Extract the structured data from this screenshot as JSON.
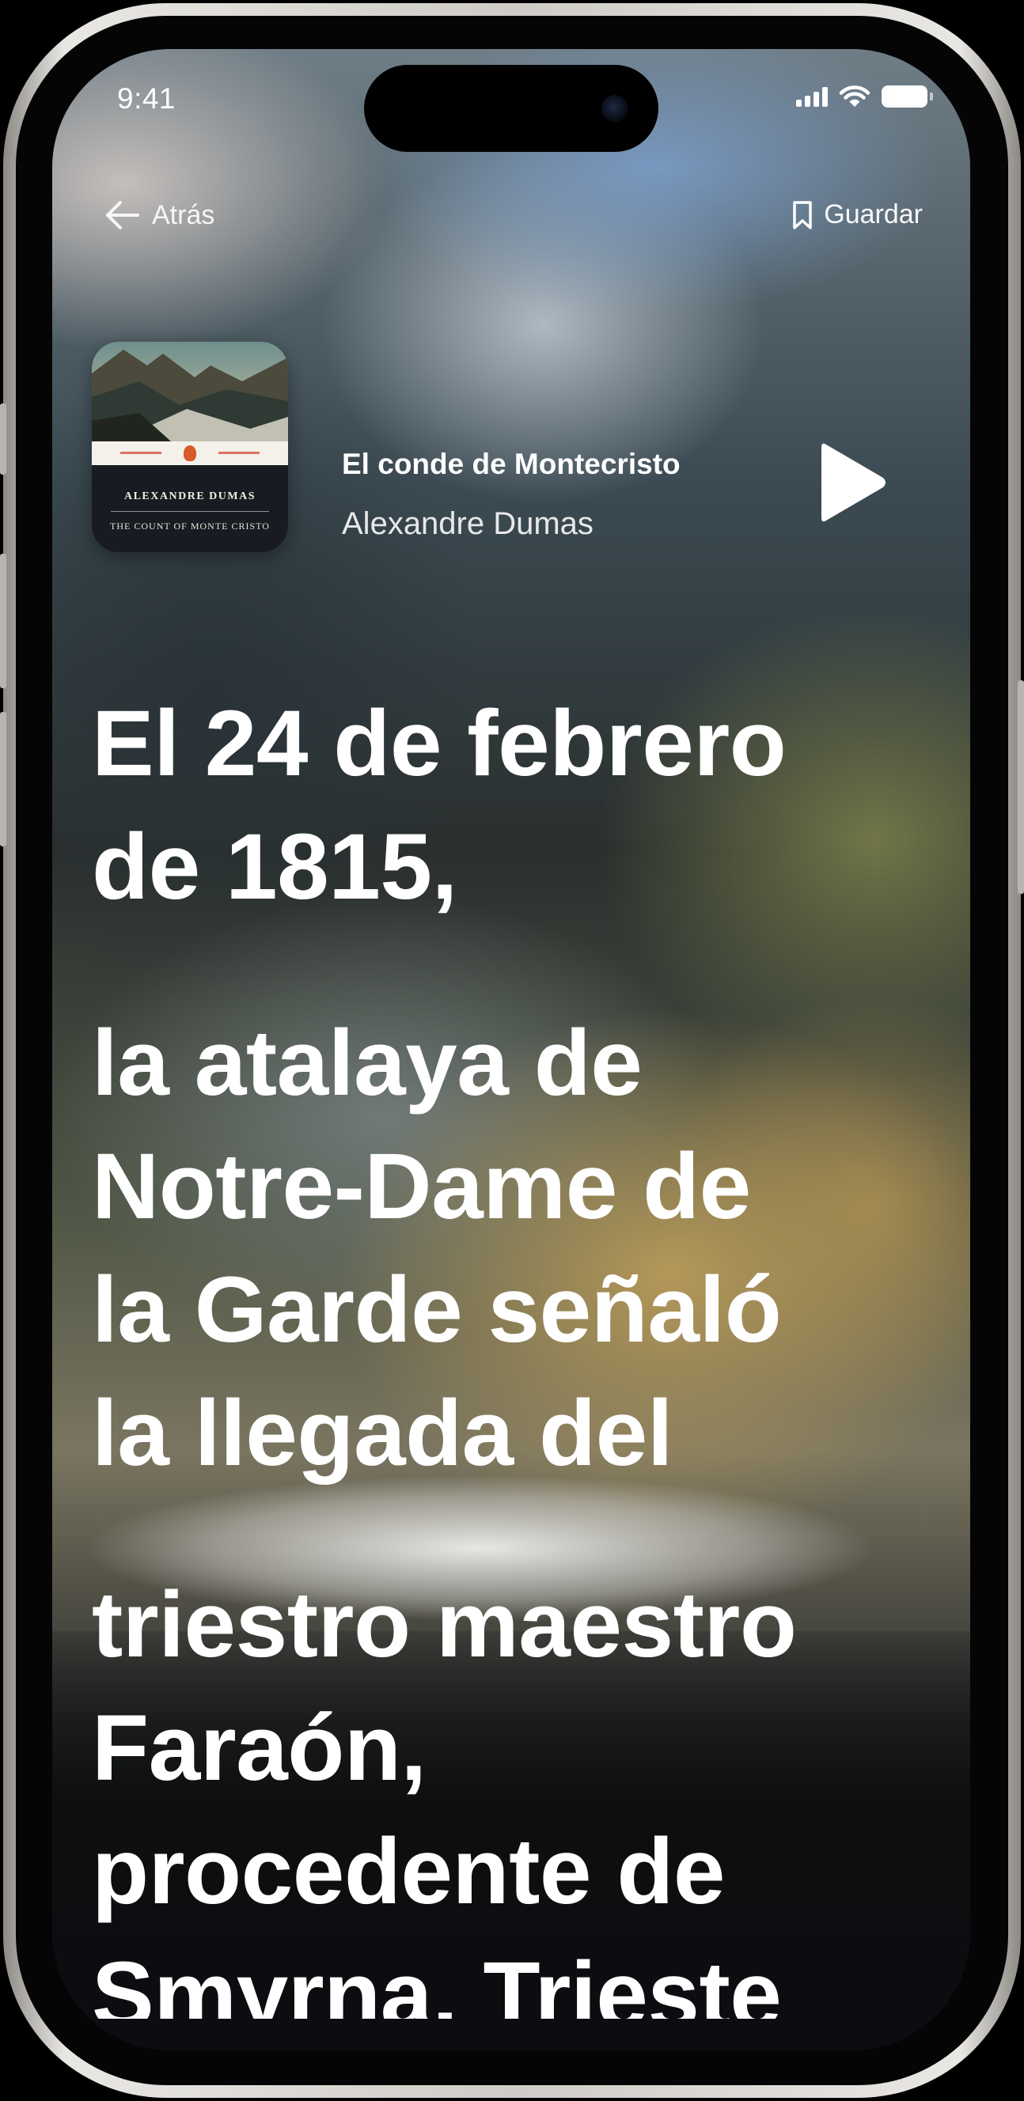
{
  "status_bar": {
    "time": "9:41",
    "icons": [
      "signal-icon",
      "wifi-icon",
      "battery-icon"
    ]
  },
  "nav": {
    "back_label": "Atrás",
    "save_label": "Guardar"
  },
  "now_playing": {
    "title": "El conde de Montecristo",
    "author": "Alexandre Dumas",
    "cover": {
      "author": "ALEXANDRE DUMAS",
      "title": "THE COUNT OF MONTE CRISTO"
    }
  },
  "reader": {
    "paragraphs": [
      [
        "El 24 de febrero",
        "de 1815,"
      ],
      [
        "la atalaya de",
        "Notre-Dame de",
        "la Garde señaló",
        "la llegada del"
      ],
      [
        "triestro maestro",
        "Faraón,",
        "procedente de",
        "Smyrna, Trieste"
      ]
    ]
  },
  "colors": {
    "text": "#ffffff",
    "phone_frame": "#e9e7e3"
  }
}
